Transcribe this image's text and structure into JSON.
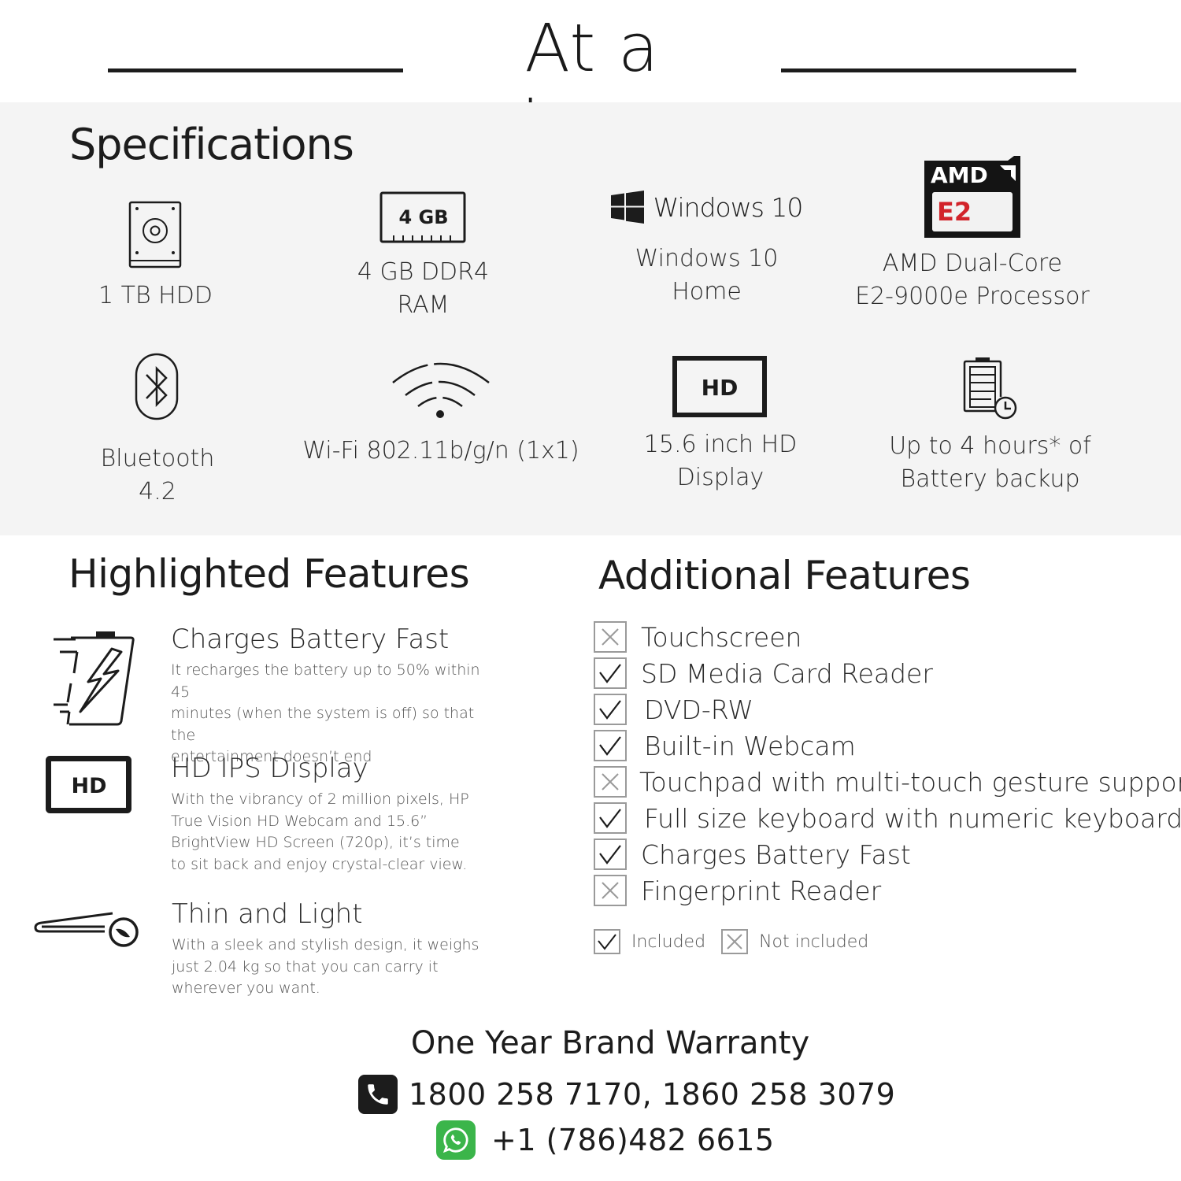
{
  "header": {
    "title": "At a glance"
  },
  "specifications": {
    "heading": "Specifications",
    "items": [
      {
        "icon": "hard-drive-icon",
        "label_lines": [
          "1 TB HDD"
        ]
      },
      {
        "icon": "memory-module-icon",
        "icon_text": "4 GB",
        "label_lines": [
          "4 GB DDR4",
          "RAM"
        ]
      },
      {
        "icon": "windows-logo-icon",
        "icon_text": "Windows 10",
        "label_lines": [
          "Windows 10",
          "Home"
        ]
      },
      {
        "icon": "amd-e2-badge-icon",
        "icon_text_top": "AMD",
        "icon_text_bottom": "E2",
        "label_lines": [
          "AMD Dual-Core",
          "E2-9000e Processor"
        ]
      },
      {
        "icon": "bluetooth-icon",
        "label_lines": [
          "Bluetooth",
          "4.2"
        ]
      },
      {
        "icon": "wifi-icon",
        "label_lines": [
          "Wi-Fi 802.11b/g/n (1x1)"
        ]
      },
      {
        "icon": "hd-display-icon",
        "icon_text": "HD",
        "label_lines": [
          "15.6 inch HD",
          "Display"
        ]
      },
      {
        "icon": "battery-clock-icon",
        "label_lines": [
          "Up to 4 hours* of",
          "Battery backup"
        ]
      }
    ]
  },
  "highlighted_features": {
    "heading": "Highlighted Features",
    "items": [
      {
        "icon": "fast-charge-battery-icon",
        "title": "Charges Battery Fast",
        "desc_lines": [
          "It recharges the battery up to 50% within 45",
          "minutes (when the system is off) so that the",
          "entertainment doesn’t end"
        ]
      },
      {
        "icon": "hd-display-icon",
        "icon_text": "HD",
        "title": "HD IPS Display",
        "desc_lines": [
          "With the vibrancy of 2 million pixels, HP",
          "True Vision HD Webcam and 15.6”",
          "BrightView HD Screen (720p), it’s time",
          "to sit back and enjoy crystal-clear view."
        ]
      },
      {
        "icon": "thin-laptop-feather-icon",
        "title": "Thin and Light",
        "desc_lines": [
          "With a sleek and stylish design, it weighs",
          "just 2.04 kg so that you can carry it",
          "wherever you want."
        ]
      }
    ]
  },
  "additional_features": {
    "heading": "Additional Features",
    "items": [
      {
        "label": "Touchscreen",
        "included": false
      },
      {
        "label": "SD Media Card Reader",
        "included": true
      },
      {
        "label": "DVD-RW",
        "included": true
      },
      {
        "label": "Built-in Webcam",
        "included": true
      },
      {
        "label": "Touchpad with multi-touch gesture support",
        "included": false
      },
      {
        "label": "Full size keyboard with numeric keyboard",
        "included": true
      },
      {
        "label": "Charges Battery Fast",
        "included": true
      },
      {
        "label": "Fingerprint Reader",
        "included": false
      }
    ],
    "legend": {
      "included": "Included",
      "not_included": "Not included"
    }
  },
  "warranty": {
    "title": "One Year Brand Warranty",
    "phone": "1800 258 7170, 1860 258 3079",
    "whatsapp": "+1 (786)482 6615"
  },
  "colors": {
    "text": "#1c1c1c",
    "panel": "#f4f4f4",
    "amd_red": "#d2232a",
    "whatsapp_green": "#3bb54a",
    "checkbox_border": "#9a9a9a"
  }
}
